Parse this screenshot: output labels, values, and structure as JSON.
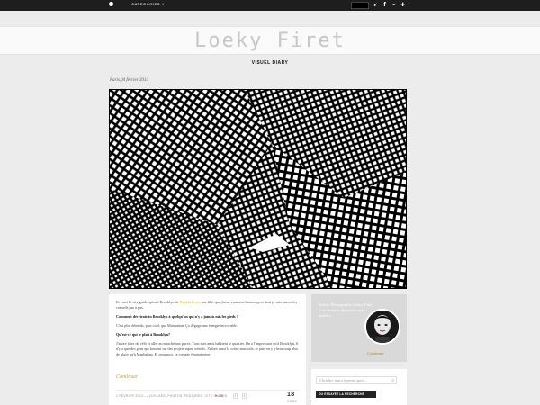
{
  "topbar": {
    "categories_label": "CATEGORIES",
    "caret": "▾",
    "social": [
      "twitter-icon",
      "facebook-icon",
      "rss-icon",
      "bloglovin-icon"
    ],
    "social_glyphs": [
      "🐦",
      "f",
      "⌁",
      "✚"
    ]
  },
  "header": {
    "logo": "Loeky Firet",
    "subtitle": "VISUEL DIARY"
  },
  "post": {
    "dateline": "Paris,04 février 2013",
    "intro_before": "Et voici le city guide spécial Brooklyn de ",
    "intro_link": "Pamela Love",
    "intro_after": ", une fille que j'aime vraiment beaucoup et dont je vais suivre les conseils pas à pas.",
    "q1": "Comment décrirais-tu Brooklyn à quelqu'un qui n'y a jamais mis les pieds ?",
    "a1": "C'est plus détendu, plus cool, que Manhattan. Ça dégage une énergie incroyable.",
    "q2": "Qu'est-ce qui te plaît à Brooklyn?",
    "a2": "J'adore faire du vélo et aller au marché aux puces. Tous mes amis habitent le quartier. On a l'impression qu'à Brooklyn, il n'y a que des gens qui bossent sur des projets super créatifs. J'adore aussi la scène musicale, et puis on y a beaucoup plus de place qu'à Manhattan. Et pour moi, ça compte énormément.",
    "continue": "Continuer",
    "meta": "1 FÉVRIER 2013 — VOYAGES, PHOTOS, FEATURES, CITY GUIDES",
    "likes": "20",
    "fb_label": "f",
    "tw_label": "t",
    "comments_count": "18",
    "comments_label": "COMS"
  },
  "sidebar": {
    "about_text": "Artiste Photographe Loeky Firet vous invite à découvrir son univers",
    "about_continue": "Continuer",
    "search_placeholder": "Chercher tout n'importe quoi...",
    "advanced_label": "OU ESSAYEZ LA RECHERCHE AVANCÉE ›"
  }
}
